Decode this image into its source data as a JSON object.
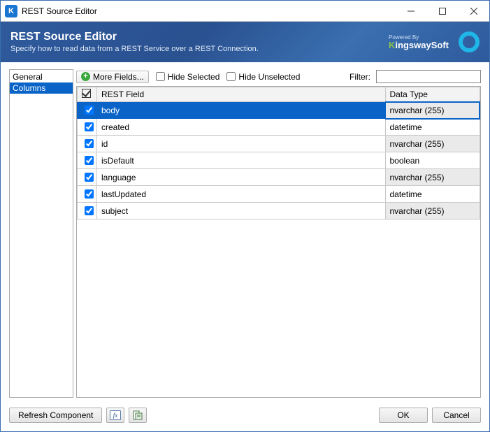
{
  "titlebar": {
    "title": "REST Source Editor"
  },
  "banner": {
    "title": "REST Source Editor",
    "subtitle": "Specify how to read data from a REST Service over a REST Connection.",
    "powered_by": "Powered By",
    "brand_prefix": "K",
    "brand_mid": "ingsway",
    "brand_suffix": "Soft"
  },
  "sidebar": {
    "general": "General",
    "columns": "Columns"
  },
  "toolbar": {
    "more_fields": "More Fields...",
    "hide_selected": "Hide Selected",
    "hide_unselected": "Hide Unselected",
    "filter_label": "Filter:",
    "filter_value": ""
  },
  "grid": {
    "header_field": "REST Field",
    "header_type": "Data Type",
    "rows": [
      {
        "field": "body",
        "type": "nvarchar (255)",
        "shaded": true,
        "selected": true
      },
      {
        "field": "created",
        "type": "datetime",
        "shaded": false,
        "selected": false
      },
      {
        "field": "id",
        "type": "nvarchar (255)",
        "shaded": true,
        "selected": false
      },
      {
        "field": "isDefault",
        "type": "boolean",
        "shaded": false,
        "selected": false
      },
      {
        "field": "language",
        "type": "nvarchar (255)",
        "shaded": true,
        "selected": false
      },
      {
        "field": "lastUpdated",
        "type": "datetime",
        "shaded": false,
        "selected": false
      },
      {
        "field": "subject",
        "type": "nvarchar (255)",
        "shaded": true,
        "selected": false
      }
    ]
  },
  "footer": {
    "refresh": "Refresh Component",
    "ok": "OK",
    "cancel": "Cancel"
  }
}
